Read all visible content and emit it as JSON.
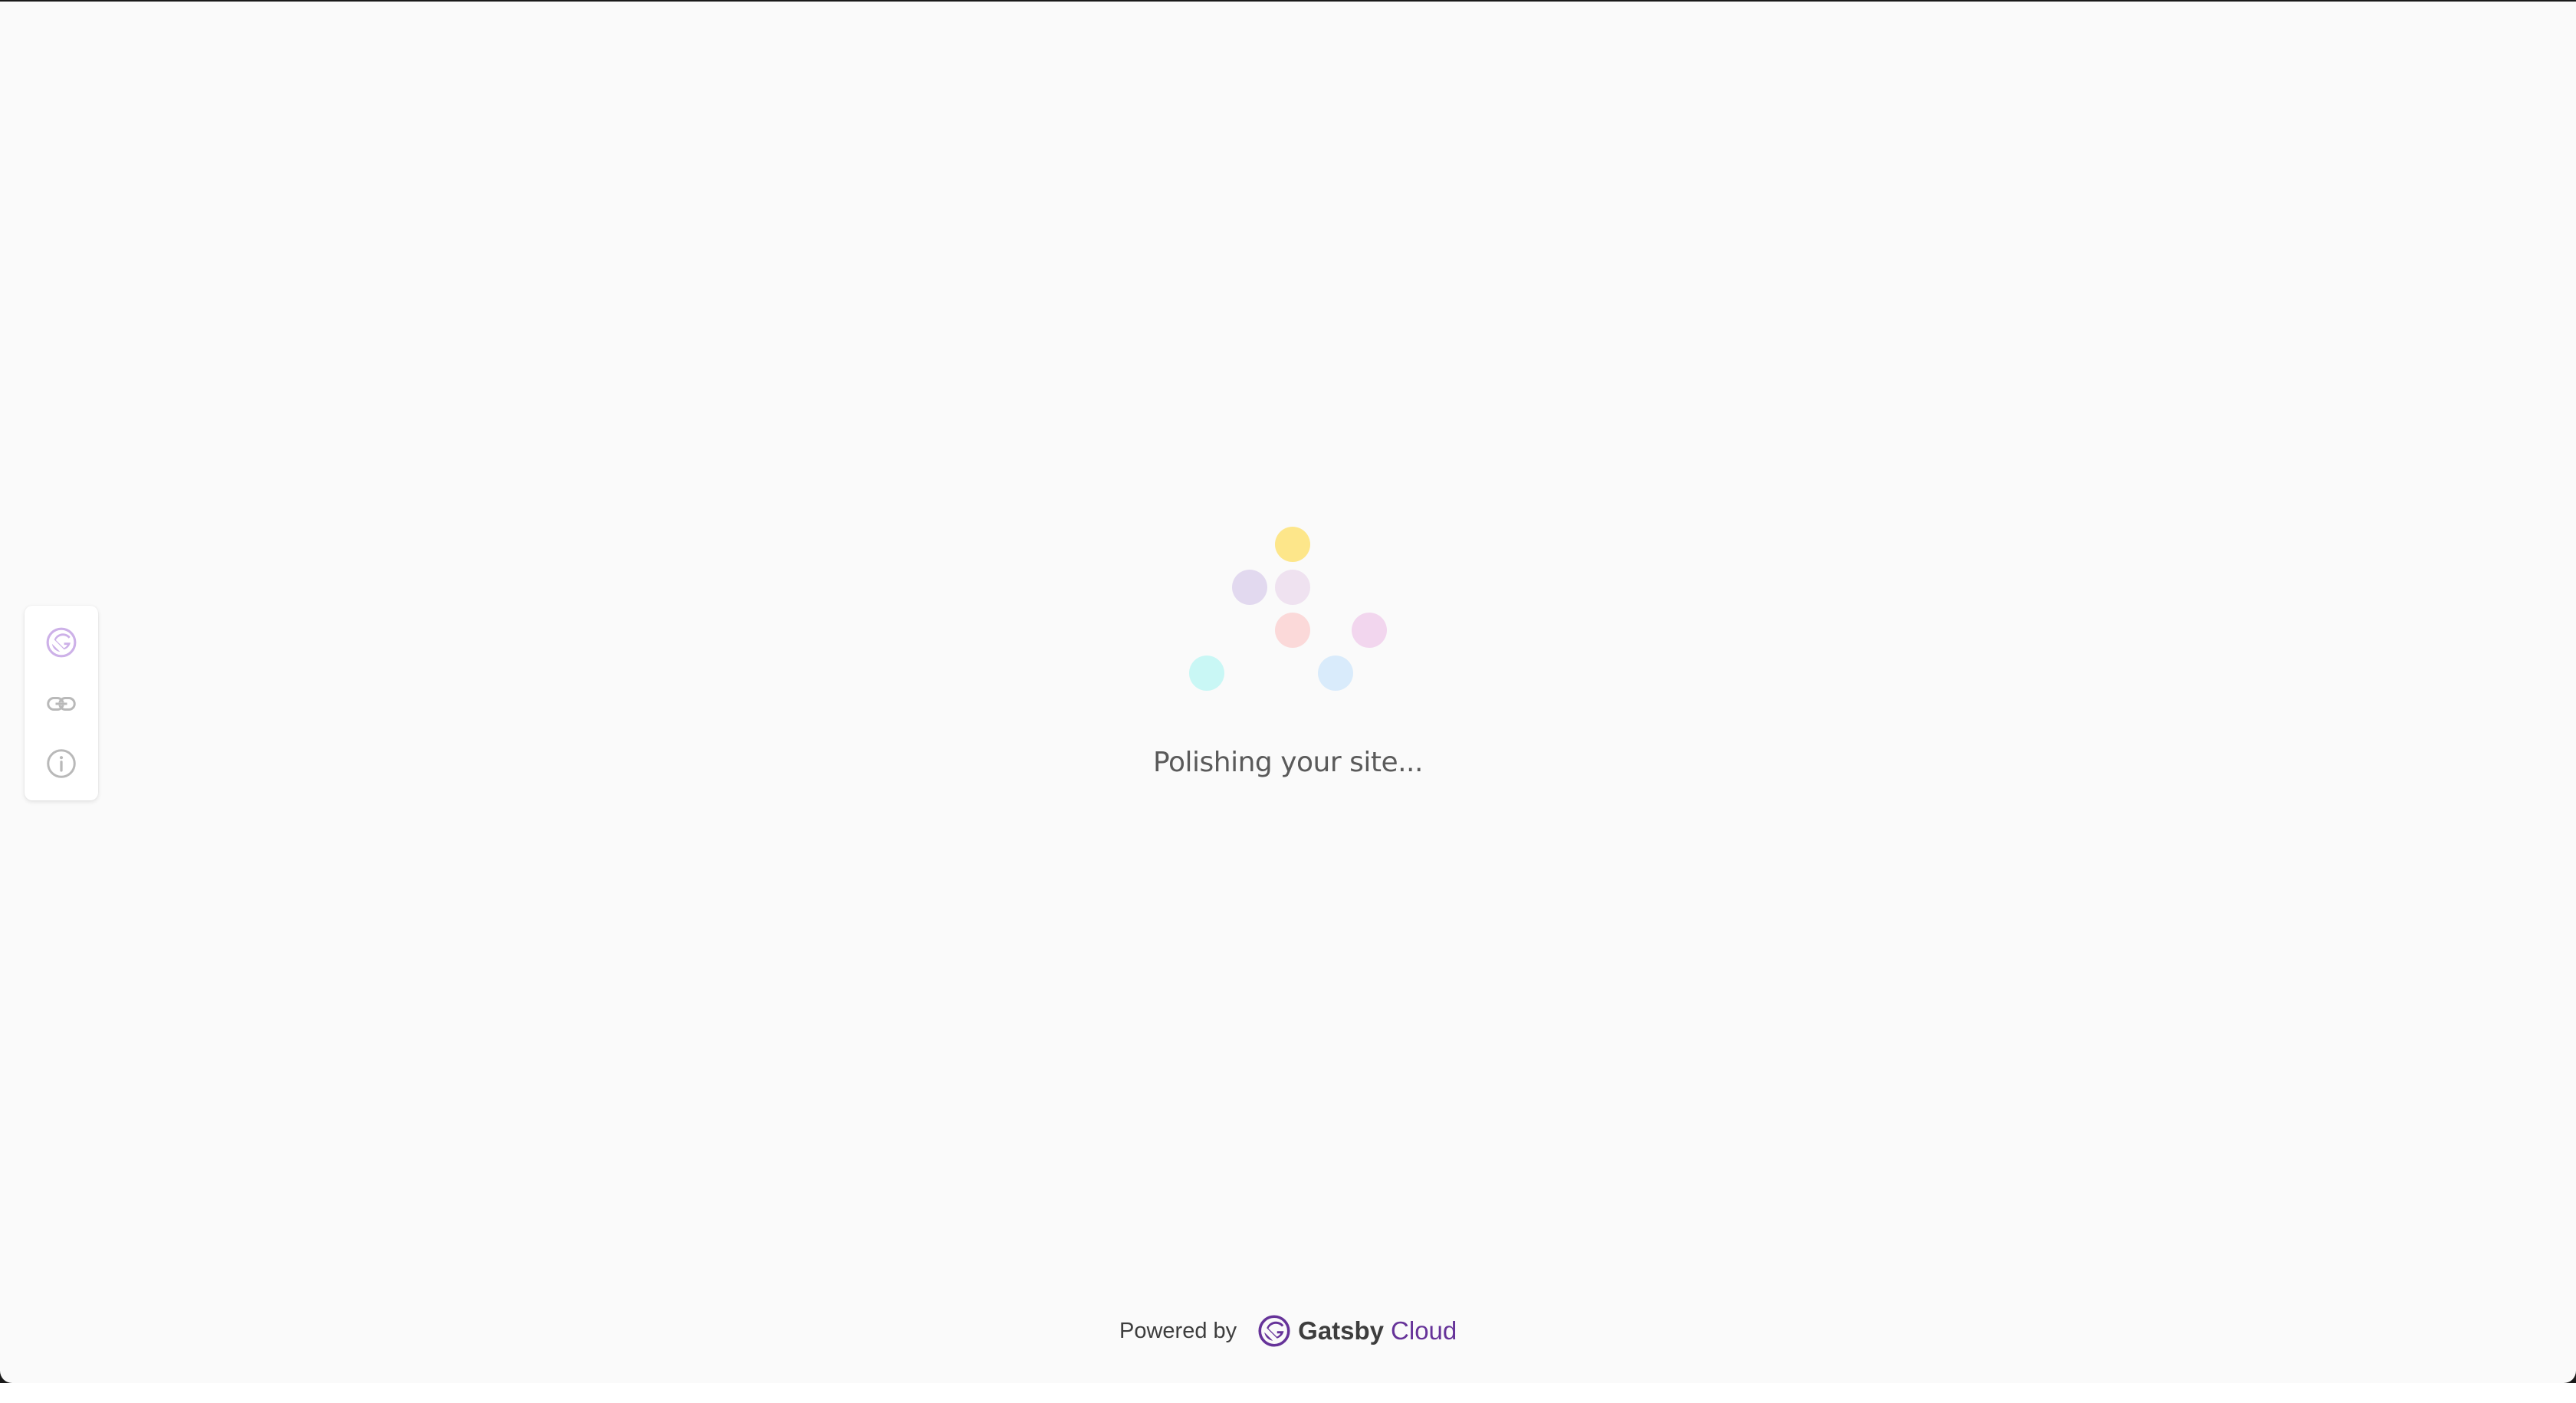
{
  "loader": {
    "status_text": "Polishing your site...",
    "dot_colors": [
      "#fde68a",
      "#e2d9ef",
      "#efe2f0",
      "#fbd9d9",
      "#f2d6ee",
      "#c9f7f5",
      "#d9ebfb"
    ]
  },
  "toolbar": {
    "items": [
      {
        "icon": "gatsby-logo-icon",
        "active": true
      },
      {
        "icon": "link-icon"
      },
      {
        "icon": "info-icon"
      }
    ]
  },
  "footer": {
    "powered_by": "Powered by",
    "brand_name": "Gatsby",
    "brand_suffix": "Cloud",
    "brand_color": "#663399"
  },
  "colors": {
    "background": "#fafafa",
    "toolbar_active": "#c6a7e3",
    "toolbar_inactive": "#b9b9b9"
  }
}
